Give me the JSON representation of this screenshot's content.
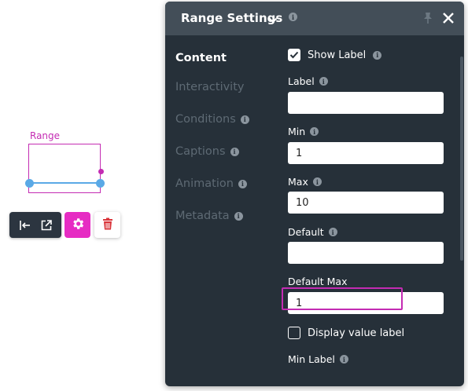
{
  "canvas": {
    "widget_label": "Range"
  },
  "panel": {
    "title": "Range Settings",
    "nav": [
      {
        "label": "Content",
        "active": true,
        "info": false
      },
      {
        "label": "Interactivity",
        "active": false,
        "info": false
      },
      {
        "label": "Conditions",
        "active": false,
        "info": true
      },
      {
        "label": "Captions",
        "active": false,
        "info": true
      },
      {
        "label": "Animation",
        "active": false,
        "info": true
      },
      {
        "label": "Metadata",
        "active": false,
        "info": true
      }
    ],
    "content": {
      "show_label": {
        "label": "Show Label",
        "checked": true
      },
      "label_field": {
        "label": "Label",
        "value": ""
      },
      "min_field": {
        "label": "Min",
        "value": "1"
      },
      "max_field": {
        "label": "Max",
        "value": "10"
      },
      "default_field": {
        "label": "Default",
        "value": ""
      },
      "default_max_field": {
        "label": "Default Max",
        "value": "1"
      },
      "display_value_label": {
        "label": "Display value label",
        "checked": false
      },
      "min_label_partial": "Min Label"
    }
  },
  "colors": {
    "panel_bg": "#263039",
    "header_bg": "#434e58",
    "accent_magenta": "#c42cb3",
    "gear_button": "#e62cc3",
    "range_blue": "#5aa9e6",
    "trash_red": "#d9343a"
  },
  "icons": {
    "title_chevron": "chevron-down-icon",
    "pin": "pin-icon",
    "close": "close-icon",
    "info": "info-icon",
    "align_left": "align-left-icon",
    "open_external": "open-external-icon",
    "gear": "gear-icon",
    "trash": "trash-icon"
  }
}
